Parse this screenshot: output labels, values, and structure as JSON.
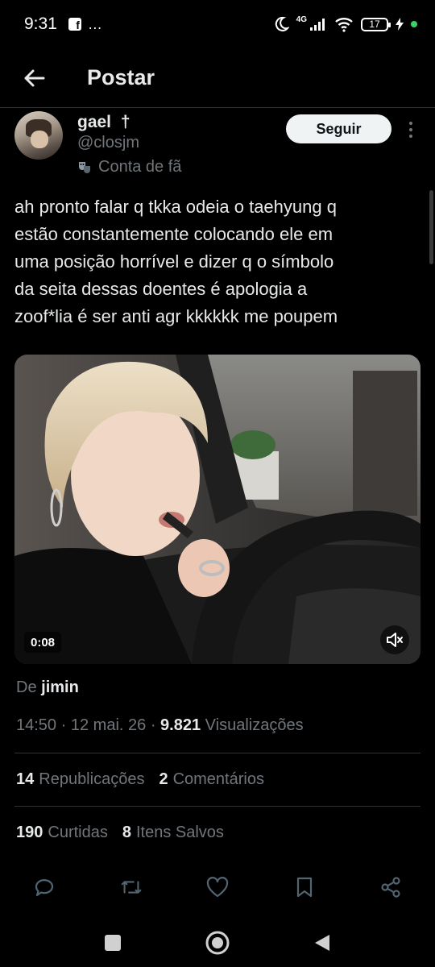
{
  "status_bar": {
    "time": "9:31",
    "app_icon": "facebook-icon",
    "overflow": "…",
    "network": "4G",
    "battery": "17"
  },
  "header": {
    "title": "Postar",
    "back_icon": "arrow-left-icon"
  },
  "author": {
    "name": "gael",
    "name_symbol": "†",
    "handle": "@closjm",
    "badge_label": "Conta de fã",
    "badge_icon": "theater-masks-icon",
    "follow_label": "Seguir"
  },
  "tweet": {
    "text": "ah pronto falar q tkka odeia o taehyung q\nestão constantemente colocando ele em\numa posição horrível e dizer q o símbolo\nda seita dessas doentes é apologia a\nzoof*lia é ser anti agr kkkkkk me poupem"
  },
  "media": {
    "duration": "0:08",
    "volume_icon": "speaker-muted-icon"
  },
  "source": {
    "prefix": "De",
    "name": "jimin"
  },
  "meta": {
    "time": "14:50",
    "sep1": "·",
    "date": "12 mai. 26",
    "sep2": "·",
    "views": "9.821",
    "views_label": "Visualizações"
  },
  "stats": {
    "reposts": "14",
    "reposts_label": "Republicações",
    "comments": "2",
    "comments_label": "Comentários",
    "likes": "190",
    "likes_label": "Curtidas",
    "bookmarks": "8",
    "bookmarks_label": "Itens Salvos"
  },
  "actions": [
    "reply-icon",
    "repost-icon",
    "like-icon",
    "bookmark-icon",
    "share-icon"
  ],
  "colors": {
    "background": "#000000",
    "text": "#e7e9ea",
    "muted": "#71767b",
    "divider": "#2f3336",
    "follow_bg": "#eff3f4"
  }
}
